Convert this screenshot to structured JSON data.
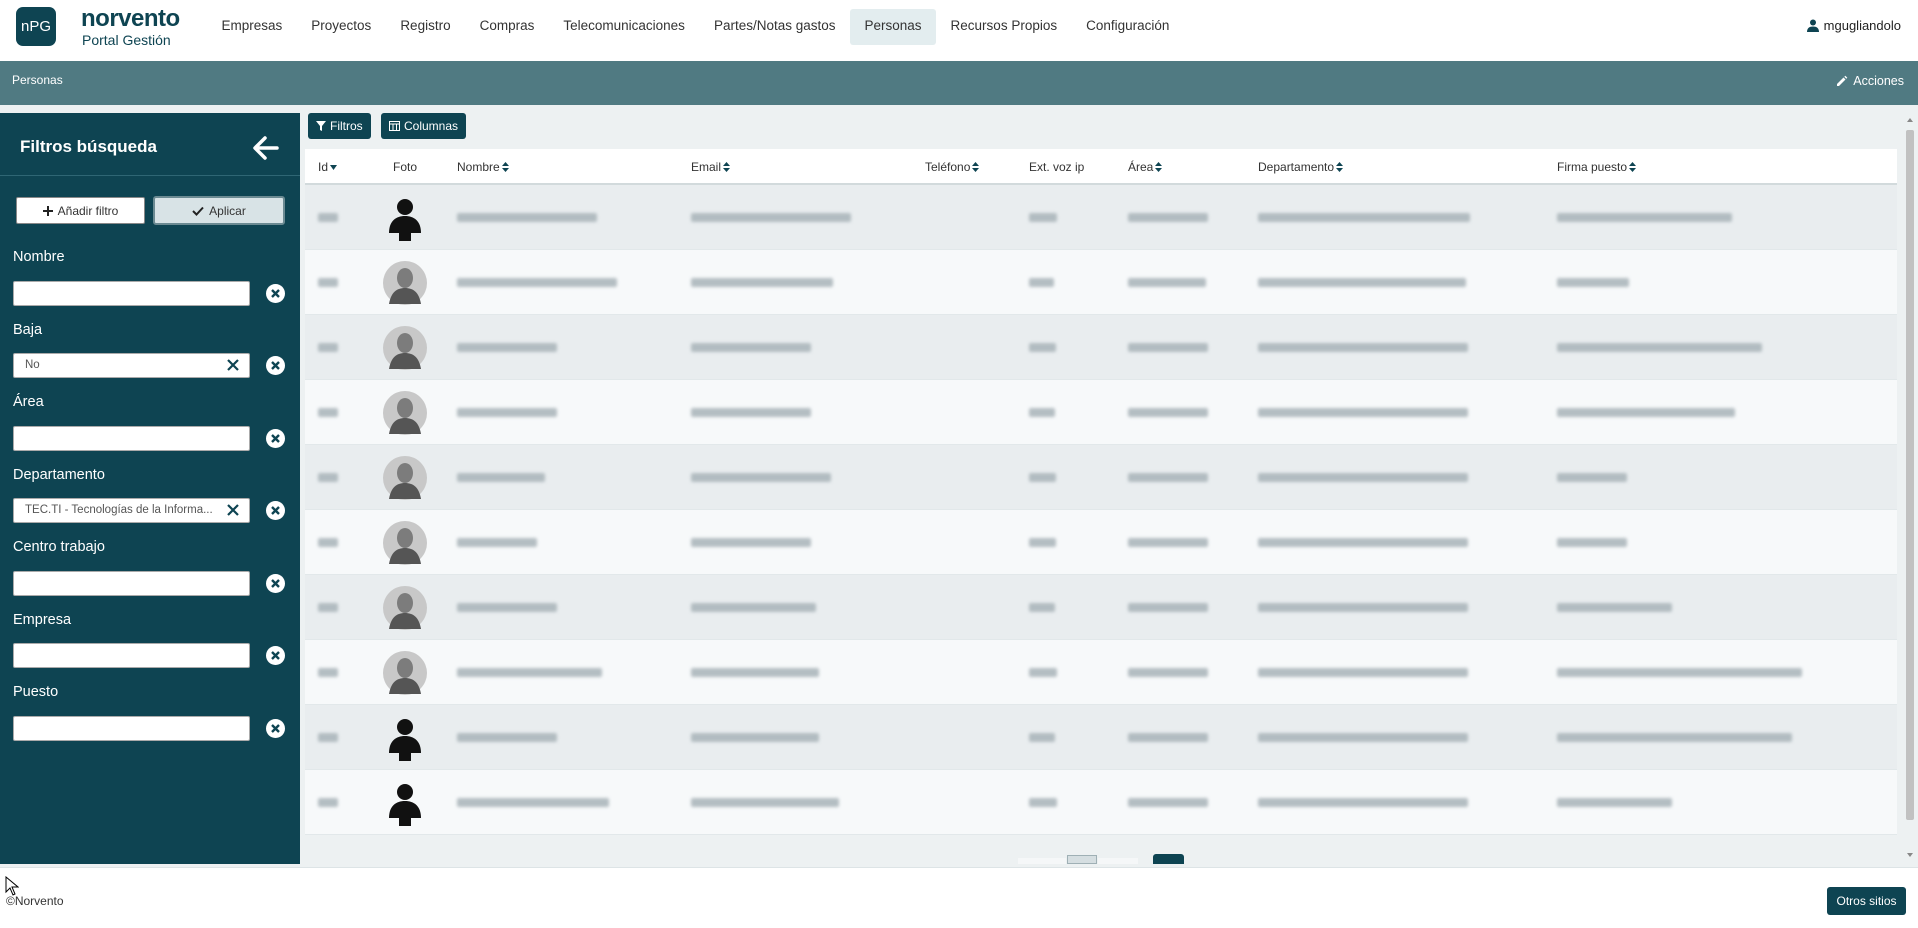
{
  "app": {
    "logo": "nPG",
    "brand": "norvento",
    "subtitle": "Portal Gestión"
  },
  "nav": {
    "items": [
      {
        "label": "Empresas"
      },
      {
        "label": "Proyectos"
      },
      {
        "label": "Registro"
      },
      {
        "label": "Compras"
      },
      {
        "label": "Telecomunicaciones"
      },
      {
        "label": "Partes/Notas gastos"
      },
      {
        "label": "Personas",
        "active": true
      },
      {
        "label": "Recursos Propios"
      },
      {
        "label": "Configuración"
      }
    ]
  },
  "user": {
    "name": "mgugliandolo"
  },
  "page": {
    "title": "Personas",
    "actions_label": "Acciones"
  },
  "sidebar": {
    "title": "Filtros búsqueda",
    "add_filter_label": "Añadir filtro",
    "apply_label": "Aplicar",
    "filters": [
      {
        "label": "Nombre",
        "value": ""
      },
      {
        "label": "Baja",
        "value": "No"
      },
      {
        "label": "Área",
        "value": ""
      },
      {
        "label": "Departamento",
        "value": "TEC.TI - Tecnologías de la Informa..."
      },
      {
        "label": "Centro trabajo",
        "value": ""
      },
      {
        "label": "Empresa",
        "value": ""
      },
      {
        "label": "Puesto",
        "value": ""
      }
    ]
  },
  "toolbar": {
    "filtros_label": "Filtros",
    "columnas_label": "Columnas"
  },
  "table": {
    "columns": [
      "Id",
      "Foto",
      "Nombre",
      "Email",
      "Teléfono",
      "Ext. voz ip",
      "Área",
      "Departamento",
      "Firma puesto"
    ]
  },
  "footer": {
    "copyright": "©Norvento",
    "otros_label": "Otros sitios"
  },
  "colors": {
    "brand": "#0e4452",
    "titlebar": "#507a82",
    "active_nav": "#e3edef"
  }
}
